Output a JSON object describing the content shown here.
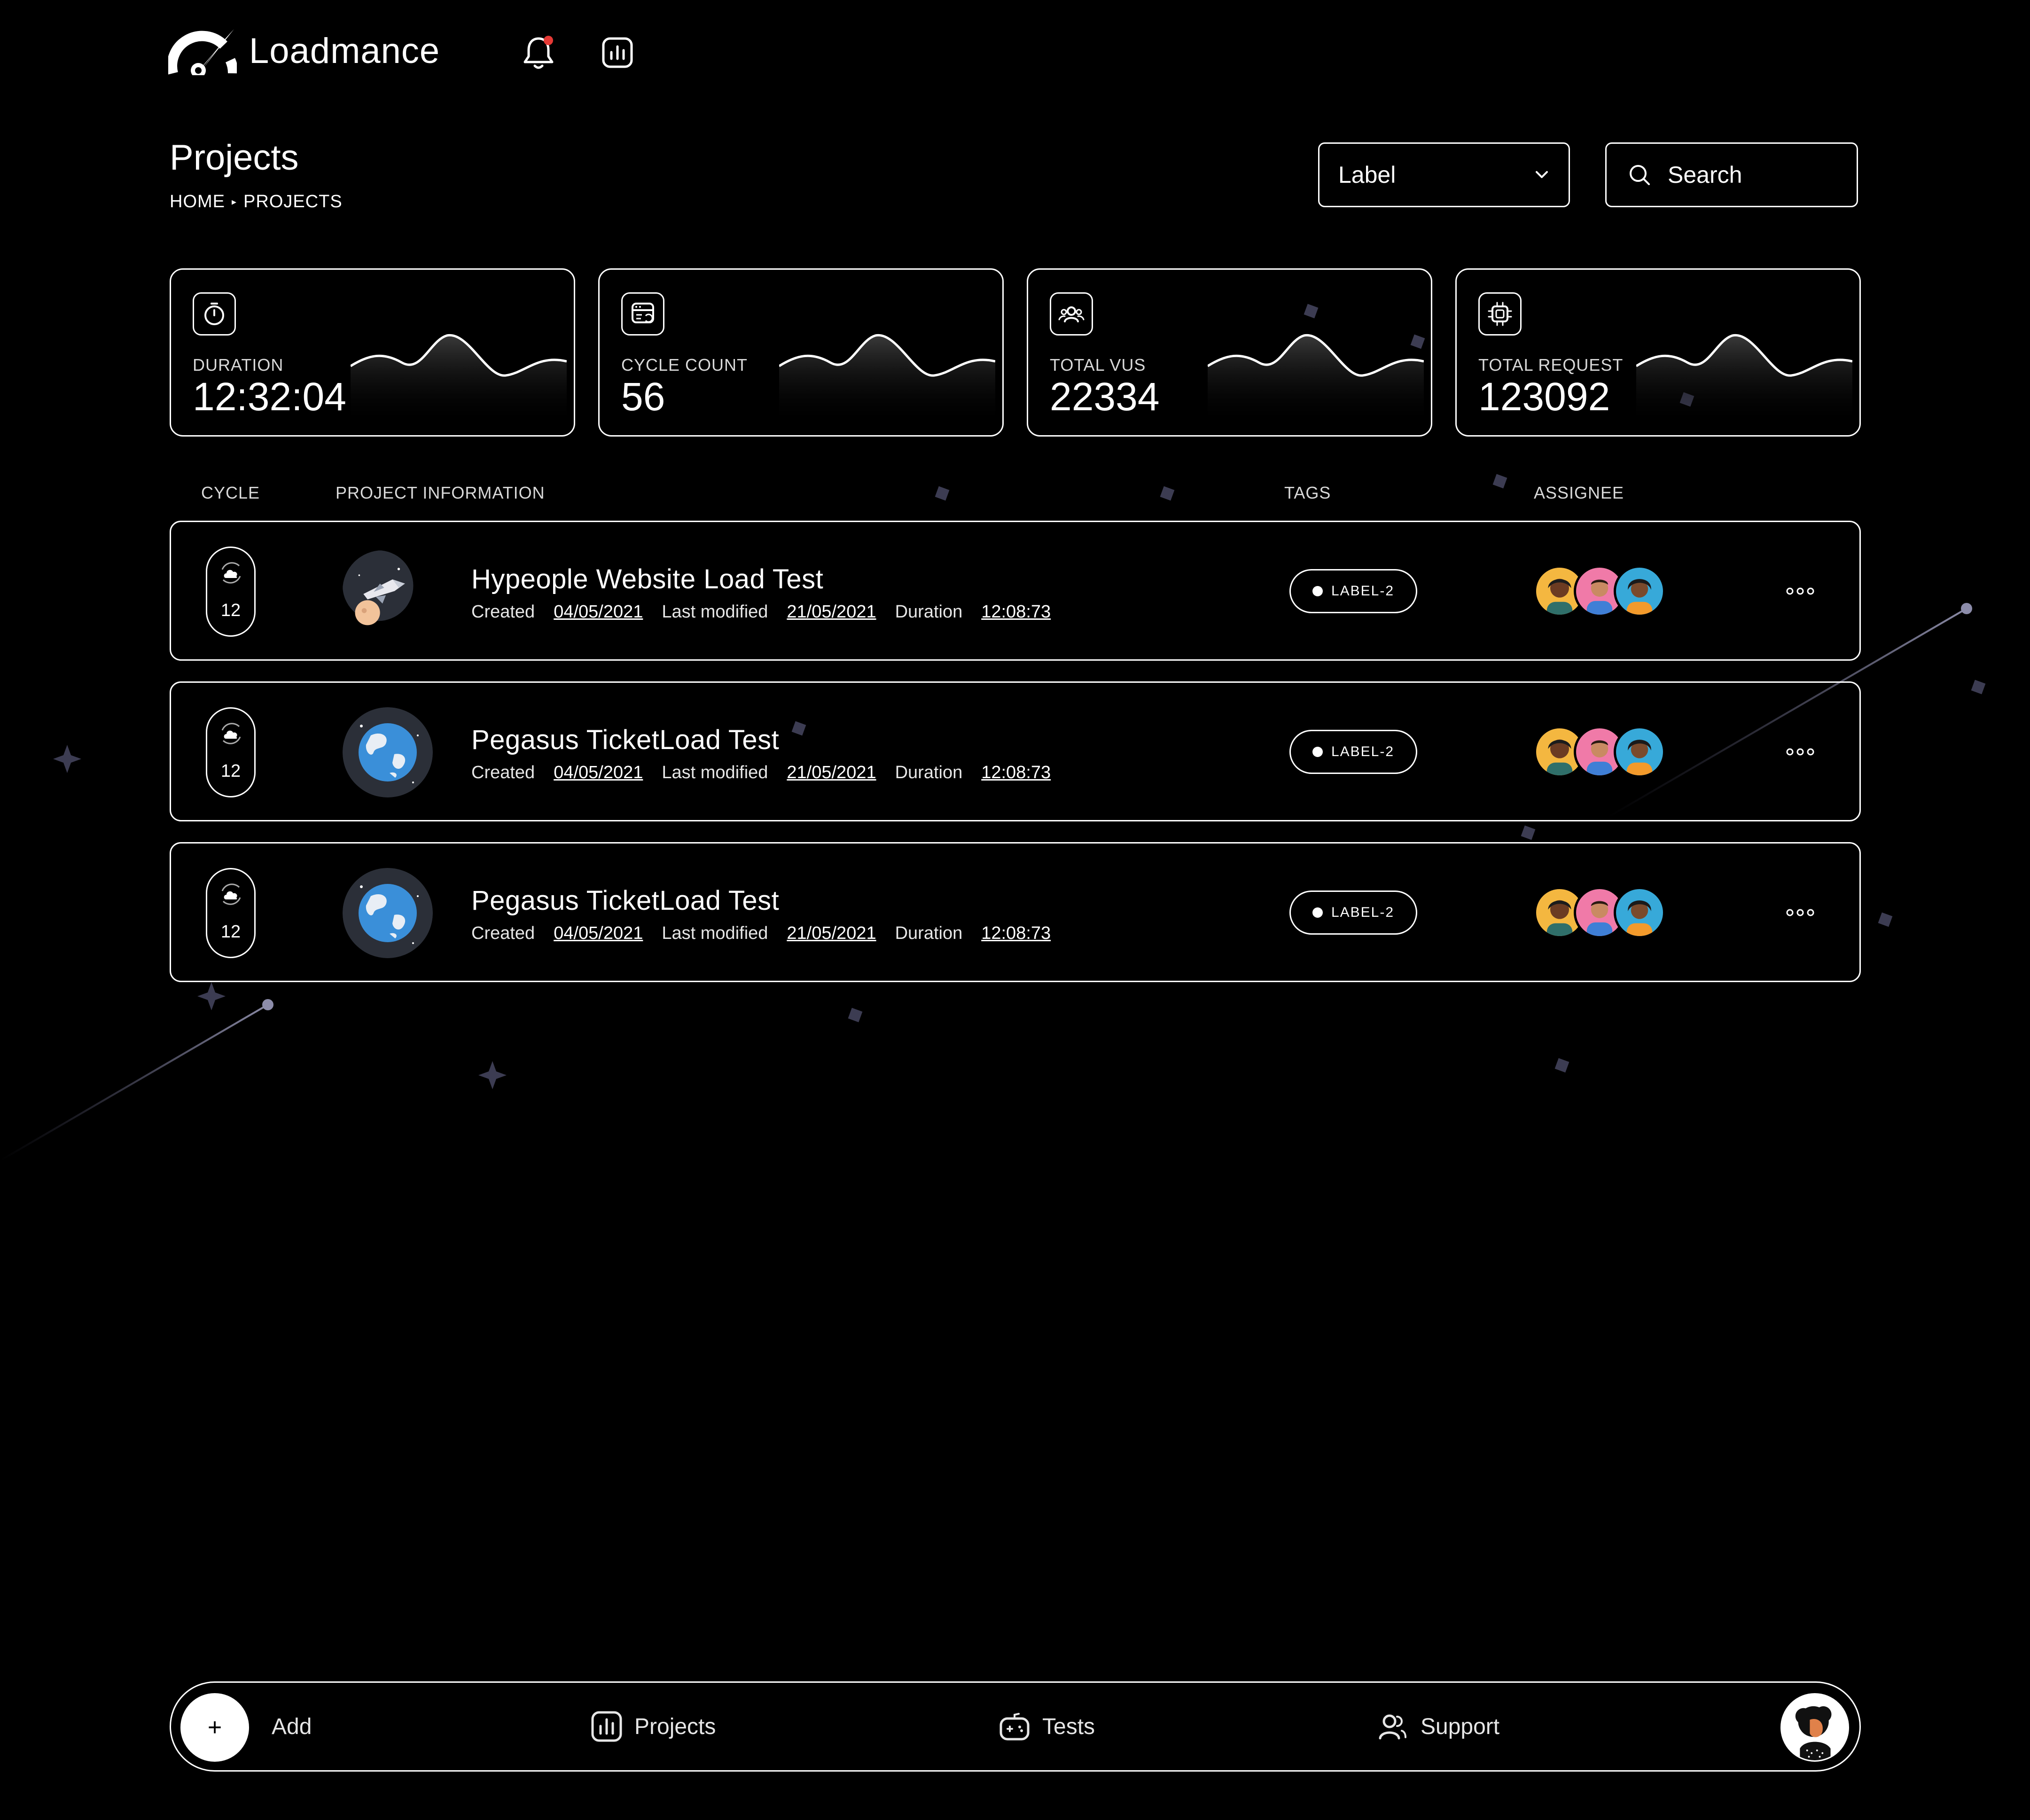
{
  "app": {
    "name": "Loadmance",
    "brand_color": "#ffffff",
    "notification_dot_color": "#e53935"
  },
  "header": {
    "icons": [
      "logo-gauge-icon",
      "bell-icon",
      "chart-icon"
    ]
  },
  "page": {
    "title": "Projects",
    "breadcrumb": [
      "HOME",
      "PROJECTS"
    ]
  },
  "filters": {
    "label_select": "Label",
    "search_placeholder": "Search"
  },
  "stats": [
    {
      "label": "DURATION",
      "value": "12:32:04",
      "icon": "stopwatch-icon"
    },
    {
      "label": "CYCLE COUNT",
      "value": "56",
      "icon": "server-cycle-icon"
    },
    {
      "label": "TOTAL VUS",
      "value": "22334",
      "icon": "users-group-icon"
    },
    {
      "label": "TOTAL REQUEST",
      "value": "123092",
      "icon": "cpu-chip-icon"
    }
  ],
  "table": {
    "headers": {
      "cycle": "CYCLE",
      "info": "PROJECT INFORMATION",
      "tags": "TAGS",
      "assignee": "ASSIGNEE"
    },
    "rows": [
      {
        "cycle": "12",
        "name": "Hypeople Website Load Test",
        "created_label": "Created",
        "created": "04/05/2021",
        "modified_label": "Last modified",
        "modified": "21/05/2021",
        "duration_label": "Duration",
        "duration": "12:08:73",
        "tag": "LABEL-2",
        "image": "rocket-illustration"
      },
      {
        "cycle": "12",
        "name": "Pegasus TicketLoad Test",
        "created_label": "Created",
        "created": "04/05/2021",
        "modified_label": "Last modified",
        "modified": "21/05/2021",
        "duration_label": "Duration",
        "duration": "12:08:73",
        "tag": "LABEL-2",
        "image": "earth-illustration"
      },
      {
        "cycle": "12",
        "name": "Pegasus TicketLoad Test",
        "created_label": "Created",
        "created": "04/05/2021",
        "modified_label": "Last modified",
        "modified": "21/05/2021",
        "duration_label": "Duration",
        "duration": "12:08:73",
        "tag": "LABEL-2",
        "image": "earth-illustration"
      }
    ]
  },
  "bottom_nav": {
    "add": "Add",
    "projects": "Projects",
    "tests": "Tests",
    "support": "Support"
  }
}
